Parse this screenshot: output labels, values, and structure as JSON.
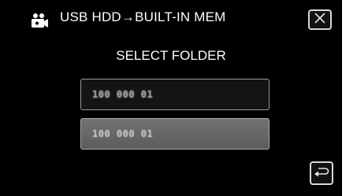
{
  "header": {
    "mode_icon": "video-camera-icon",
    "title": "USB HDD→BUILT-IN MEM",
    "close_icon": "close-x-icon"
  },
  "screen": {
    "subtitle": "SELECT FOLDER"
  },
  "folders": [
    {
      "label": "100 000 01",
      "state": "selected"
    },
    {
      "label": "100 000 01",
      "state": "normal"
    }
  ],
  "footer": {
    "back_icon": "return-arrow-icon"
  },
  "colors": {
    "background": "#000000",
    "text": "#ffffff",
    "button_border": "#d8d8d8",
    "folder_selected_bg": "#141414",
    "folder_normal_bg": "#6a6a6a"
  }
}
